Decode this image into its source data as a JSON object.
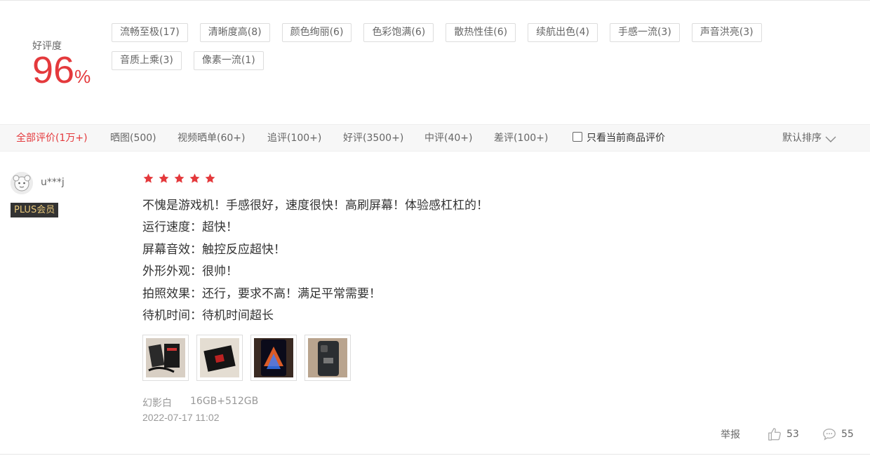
{
  "rating": {
    "label": "好评度",
    "value": "96",
    "unit": "%"
  },
  "tags": [
    "流畅至极(17)",
    "清晰度高(8)",
    "颜色绚丽(6)",
    "色彩饱满(6)",
    "散热性佳(6)",
    "续航出色(4)",
    "手感一流(3)",
    "声音洪亮(3)",
    "音质上乘(3)",
    "像素一流(1)"
  ],
  "filters": {
    "tabs": [
      "全部评价(1万+)",
      "晒图(500)",
      "视频晒单(60+)",
      "追评(100+)",
      "好评(3500+)",
      "中评(40+)",
      "差评(100+)"
    ],
    "active_index": 0,
    "only_current_label": "只看当前商品评价",
    "only_current_checked": false,
    "sort_label": "默认排序"
  },
  "review": {
    "username": "u***j",
    "member_badge": "PLUS会员",
    "stars": 5,
    "lines": [
      "不愧是游戏机！手感很好，速度很快！高刷屏幕！体验感杠杠的！",
      "运行速度：超快！",
      "屏幕音效：触控反应超快！",
      "外形外观：很帅！",
      "拍照效果：还行，要求不高！满足平常需要！",
      "待机时间：待机时间超长"
    ],
    "image_count": 4,
    "color": "幻影白",
    "storage": "16GB+512GB",
    "date": "2022-07-17 11:02",
    "report_label": "举报",
    "likes": "53",
    "comments": "55"
  },
  "colors": {
    "accent": "#e4393c",
    "badge_bg": "#333333",
    "badge_text": "#e8c779"
  }
}
